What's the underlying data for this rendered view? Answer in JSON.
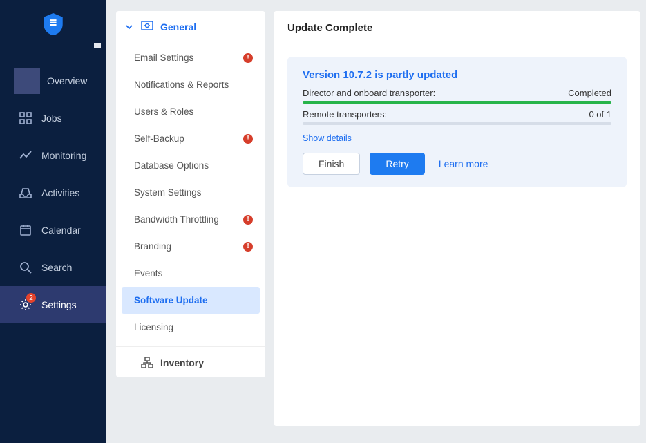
{
  "sidebar": {
    "items": [
      {
        "label": "Overview"
      },
      {
        "label": "Jobs"
      },
      {
        "label": "Monitoring"
      },
      {
        "label": "Activities"
      },
      {
        "label": "Calendar"
      },
      {
        "label": "Search"
      },
      {
        "label": "Settings",
        "badge": "2"
      }
    ]
  },
  "settings_nav": {
    "general": {
      "header": "General",
      "items": [
        {
          "label": "Email Settings",
          "alert": true
        },
        {
          "label": "Notifications & Reports",
          "alert": false
        },
        {
          "label": "Users & Roles",
          "alert": false
        },
        {
          "label": "Self-Backup",
          "alert": true
        },
        {
          "label": "Database Options",
          "alert": false
        },
        {
          "label": "System Settings",
          "alert": false
        },
        {
          "label": "Bandwidth Throttling",
          "alert": true
        },
        {
          "label": "Branding",
          "alert": true
        },
        {
          "label": "Events",
          "alert": false
        },
        {
          "label": "Software Update",
          "alert": false,
          "active": true
        },
        {
          "label": "Licensing",
          "alert": false
        }
      ]
    },
    "inventory": {
      "header": "Inventory"
    }
  },
  "main": {
    "title": "Update Complete",
    "update": {
      "heading": "Version 10.7.2 is partly updated",
      "row1_label": "Director and onboard transporter:",
      "row1_status": "Completed",
      "row1_pct": 100,
      "row2_label": "Remote transporters:",
      "row2_status": "0 of 1",
      "row2_pct": 0,
      "show_details": "Show details",
      "finish": "Finish",
      "retry": "Retry",
      "learn_more": "Learn more"
    }
  }
}
